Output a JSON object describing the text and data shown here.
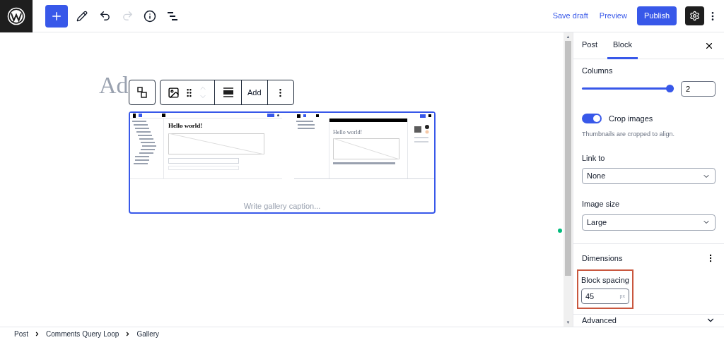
{
  "top_bar": {
    "tools": [
      {
        "kind": "inserter",
        "disabled": false
      },
      {
        "kind": "edit",
        "disabled": false
      },
      {
        "kind": "undo",
        "disabled": false
      },
      {
        "kind": "redo",
        "disabled": true
      },
      {
        "kind": "details",
        "disabled": false
      },
      {
        "kind": "outline",
        "disabled": false
      }
    ],
    "save_draft": "Save draft",
    "preview": "Preview",
    "publish": "Publish",
    "settings_pressed": true
  },
  "canvas": {
    "title": "Ad",
    "block_toolbar": {
      "add_label": "Add"
    },
    "gallery": {
      "images": [
        {
          "kind": "editor",
          "heading": "Hello world!"
        },
        {
          "kind": "styles",
          "heading": "Hello world!"
        }
      ],
      "caption_placeholder": "Write gallery caption..."
    }
  },
  "sidebar": {
    "tabs": [
      {
        "label": "Post",
        "selected": false
      },
      {
        "label": "Block",
        "selected": true
      }
    ],
    "columns": {
      "label": "Columns",
      "level": 1,
      "value": "2"
    },
    "scroll_arrows": [
      "▲",
      "▼"
    ],
    "crop_images": {
      "label": "Crop images",
      "on": true,
      "help": "Thumbnails are cropped to align."
    },
    "link_to": {
      "label": "Link to",
      "value": "None"
    },
    "image_size": {
      "label": "Image size",
      "value": "Large"
    },
    "dimensions": {
      "title": "Dimensions",
      "block_spacing": {
        "label": "Block spacing",
        "value": "45",
        "unit": "px",
        "highlighted": true
      }
    },
    "advanced": {
      "title": "Advanced"
    }
  },
  "breadcrumb": [
    "Post",
    "Comments Query Loop",
    "Gallery"
  ]
}
